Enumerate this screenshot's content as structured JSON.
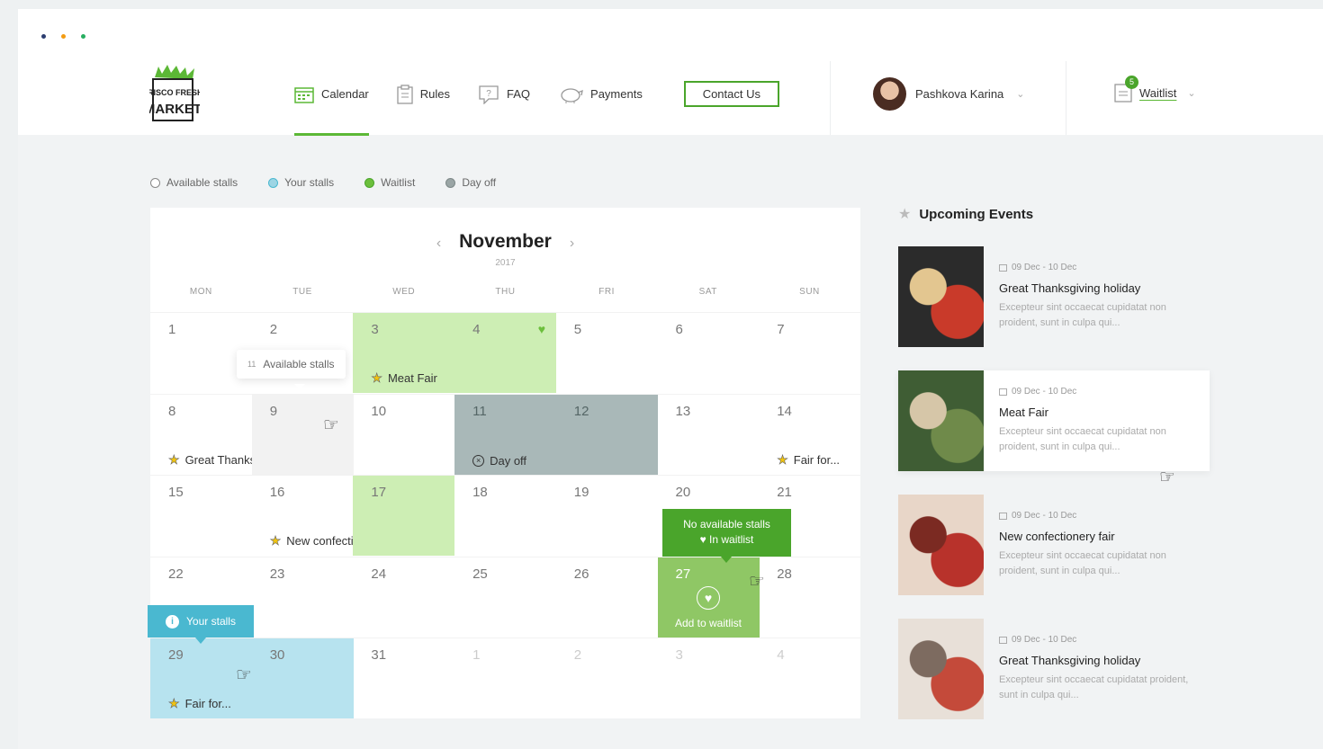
{
  "window": {
    "dot_colors": [
      "#2c3e70",
      "#f39c12",
      "#27ae60"
    ]
  },
  "nav": {
    "items": [
      {
        "label": "Calendar",
        "icon": "calendar-icon",
        "active": true
      },
      {
        "label": "Rules",
        "icon": "clipboard-icon",
        "active": false
      },
      {
        "label": "FAQ",
        "icon": "question-icon",
        "active": false
      },
      {
        "label": "Payments",
        "icon": "piggy-bank-icon",
        "active": false
      }
    ],
    "contact_label": "Contact Us"
  },
  "user": {
    "name": "Pashkova Karina"
  },
  "waitlist_top": {
    "label": "Waitlist",
    "count": "5"
  },
  "legend": [
    {
      "label": "Available stalls",
      "color": "#ffffff"
    },
    {
      "label": "Your stalls",
      "color": "#4ab8d0"
    },
    {
      "label": "Waitlist",
      "color": "#6cbf3c"
    },
    {
      "label": "Day off",
      "color": "#9aa5a5"
    }
  ],
  "calendar": {
    "month": "November",
    "year": "2017",
    "weekdays": [
      "MON",
      "TUE",
      "WED",
      "THU",
      "FRI",
      "SAT",
      "SUN"
    ],
    "days": [
      {
        "n": "1"
      },
      {
        "n": "2"
      },
      {
        "n": "3",
        "state": "waitlist",
        "event": "Meat Fair"
      },
      {
        "n": "4",
        "state": "waitlist",
        "heart": true
      },
      {
        "n": "5"
      },
      {
        "n": "6"
      },
      {
        "n": "7"
      },
      {
        "n": "8",
        "event": "Great Thanksgiving holiday"
      },
      {
        "n": "9",
        "state": "hover"
      },
      {
        "n": "10"
      },
      {
        "n": "11",
        "state": "dayoff",
        "dayoff_label": "Day off"
      },
      {
        "n": "12",
        "state": "dayoff"
      },
      {
        "n": "13"
      },
      {
        "n": "14",
        "event": "Fair for..."
      },
      {
        "n": "15"
      },
      {
        "n": "16",
        "event": "New confectionery fair"
      },
      {
        "n": "17",
        "state": "waitlist"
      },
      {
        "n": "18"
      },
      {
        "n": "19"
      },
      {
        "n": "20"
      },
      {
        "n": "21"
      },
      {
        "n": "22"
      },
      {
        "n": "23"
      },
      {
        "n": "24"
      },
      {
        "n": "25"
      },
      {
        "n": "26"
      },
      {
        "n": "27",
        "state": "addwait",
        "action": "Add to waitlist"
      },
      {
        "n": "28"
      },
      {
        "n": "29",
        "state": "yours",
        "event": "Fair for..."
      },
      {
        "n": "30",
        "state": "yours"
      },
      {
        "n": "31"
      },
      {
        "n": "1",
        "muted": true
      },
      {
        "n": "2",
        "muted": true
      },
      {
        "n": "3",
        "muted": true
      },
      {
        "n": "4",
        "muted": true
      }
    ],
    "tooltip_available": {
      "count": "11",
      "label": "Available stalls"
    },
    "tooltip_green": {
      "line1": "No available stalls",
      "line2": "In waitlist"
    },
    "tooltip_blue": {
      "label": "Your stalls"
    }
  },
  "upcoming": {
    "title": "Upcoming Events",
    "events": [
      {
        "date": "09 Dec - 10 Dec",
        "title": "Great Thanksgiving holiday",
        "desc": "Excepteur sint occaecat cupidatat non proident, sunt in culpa qui...",
        "thumb_colors": [
          "#c93a2a",
          "#e3c690",
          "#2b2b2b"
        ]
      },
      {
        "date": "09 Dec - 10 Dec",
        "title": "Meat Fair",
        "desc": "Excepteur sint occaecat cupidatat non proident, sunt in culpa qui...",
        "thumb_colors": [
          "#6f8a4a",
          "#d6c6a8",
          "#3f5d34"
        ]
      },
      {
        "date": "09 Dec - 10 Dec",
        "title": "New confectionery fair",
        "desc": "Excepteur sint occaecat cupidatat non proident, sunt in culpa qui...",
        "thumb_colors": [
          "#b8322b",
          "#7b2a22",
          "#e8d6c8"
        ]
      },
      {
        "date": "09 Dec - 10 Dec",
        "title": "Great Thanksgiving holiday",
        "desc": "Excepteur sint occaecat cupidatat proident, sunt in culpa qui...",
        "thumb_colors": [
          "#c44a3a",
          "#7d6b60",
          "#e8e0d8"
        ]
      }
    ]
  }
}
